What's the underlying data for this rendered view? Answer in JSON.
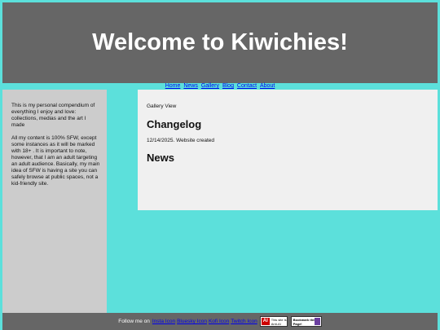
{
  "header": {
    "title": "Welcome to Kiwichies!"
  },
  "nav": {
    "items": [
      "Home",
      "News",
      "Gallery",
      "Blog",
      "Contact",
      "About"
    ]
  },
  "sidebar": {
    "paragraph1": "This is my personal compendium of everything I enjoy and love: collections, medias and the art I made",
    "paragraph2": "All my content is 100% SFW, except some instances as it will be marked with 18+ . It is important to note, however, that I am an adult targeting an adult audience. Basically, my main idea of SFW is having a site you can safely browse at public spaces, not a kid-friendly site."
  },
  "main": {
    "view_label": "Gallery View",
    "changelog_heading": "Changelog",
    "changelog_entry": "12/14/2025. Website created",
    "news_heading": "News"
  },
  "footer": {
    "follow_text": "Follow me on",
    "links": [
      "Insta Icon",
      "Bluesky Icon",
      "Kofi Icon",
      "Twitch Icon"
    ],
    "badge1_mark": "AI",
    "badge1_text": "This site is Anti-AI",
    "badge2_text": "Bookmark this Page!"
  },
  "colors": {
    "background": "#5ce0db",
    "header": "#666666",
    "sidebar": "#cccccc",
    "main": "#f0f0f0",
    "link": "#0000ee"
  }
}
